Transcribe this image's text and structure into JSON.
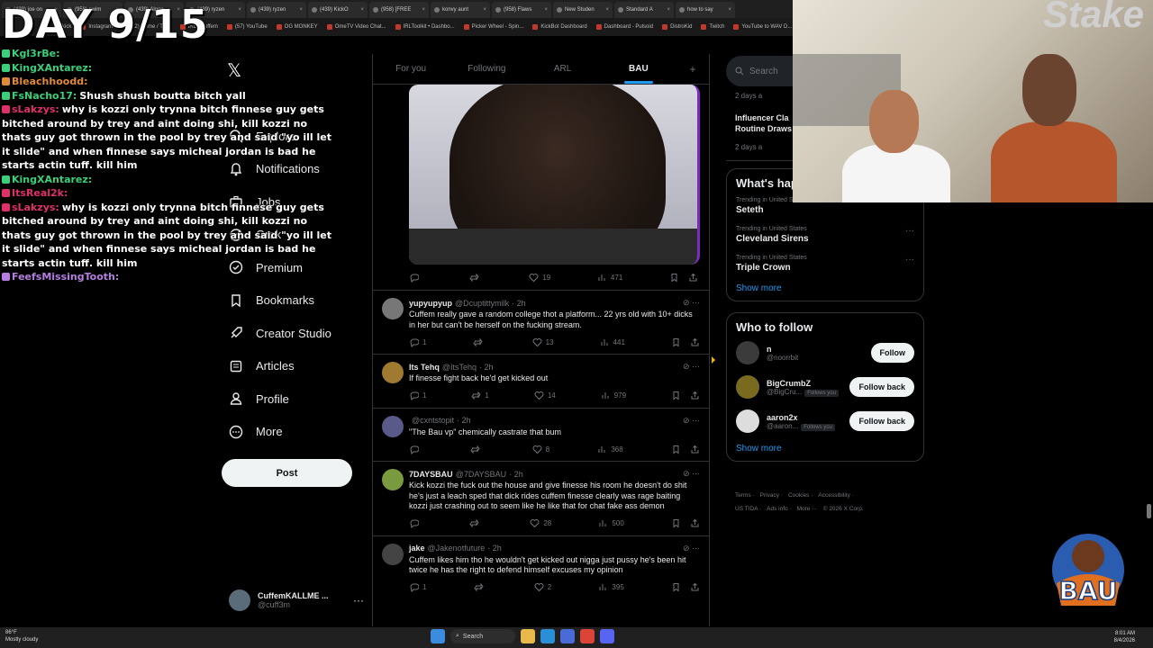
{
  "overlay": {
    "day": "DAY 9/15"
  },
  "browser": {
    "tabs": [
      "(439) joe on",
      "(958) swim",
      "(439) Algon",
      "(439) ryzen",
      "(439) ryzen",
      "(439) KickO",
      "(958) [FREE",
      "konvy aunt",
      "(958) Flaws",
      "New Studen",
      "Standard A",
      "how to say"
    ],
    "bookmarks": [
      "kick",
      "Instagram",
      "(12) Home / Twitt",
      "IRL | Cuffem",
      "(57) YouTube",
      "OG MONKEY",
      "OmeTV Video Chat...",
      "IRLToolkit • Dashbo...",
      "Picker Wheel - Spin...",
      "KickBot Dashboard",
      "Dashboard - Pulsoid",
      "DistroKid",
      "Twitch",
      "YouTube to WAV D..."
    ]
  },
  "chat": [
    {
      "user": "Kgl3rBe:",
      "text": "",
      "color": "#3ad07a"
    },
    {
      "user": "KingXAntarez:",
      "text": "",
      "color": "#3ad07a"
    },
    {
      "user": "Bleachhoodd:",
      "text": "",
      "color": "#e08a3c"
    },
    {
      "user": "FsNacho17:",
      "text": "Shush shush boutta bitch yall",
      "color": "#3ad07a"
    },
    {
      "user": "sLakzys:",
      "text": "why is kozzi only trynna bitch finnese guy gets bitched around by trey and aint doing shi, kill kozzi no thats guy got thrown in the pool by trey and said \"yo ill let it slide\" and when finnese says micheal jordan is bad he starts actin tuff. kill him",
      "color": "#e0306a"
    },
    {
      "user": "KingXAntarez:",
      "text": "",
      "color": "#3ad07a"
    },
    {
      "user": "ItsReal2k:",
      "text": "",
      "color": "#e0306a"
    },
    {
      "user": "sLakzys:",
      "text": "why is kozzi only trynna bitch finnese guy gets bitched around by trey and aint doing shi, kill kozzi no thats guy got thrown in the pool by trey and said \"yo ill let it slide\" and when finnese says micheal jordan is bad he starts actin tuff. kill him",
      "color": "#e0306a"
    },
    {
      "user": "FeefsMissingTooth:",
      "text": "",
      "color": "#b57ee0"
    }
  ],
  "nav": {
    "items": [
      {
        "label": "Explore",
        "icon": "search-icon"
      },
      {
        "label": "Notifications",
        "icon": "bell-icon"
      },
      {
        "label": "Jobs",
        "icon": "briefcase-icon"
      },
      {
        "label": "Grok",
        "icon": "grok-icon"
      },
      {
        "label": "Premium",
        "icon": "premium-icon"
      },
      {
        "label": "Bookmarks",
        "icon": "bookmark-icon"
      },
      {
        "label": "Creator Studio",
        "icon": "rocket-icon"
      },
      {
        "label": "Articles",
        "icon": "articles-icon"
      },
      {
        "label": "Profile",
        "icon": "profile-icon"
      },
      {
        "label": "More",
        "icon": "more-icon"
      }
    ],
    "post": "Post",
    "account": {
      "name": "CuffemKALLME ...",
      "handle": "@cuff3m"
    }
  },
  "timeline": {
    "tabs": [
      "For you",
      "Following",
      "ARL",
      "BAU"
    ],
    "active_tab": "BAU",
    "top_tweet_actions": {
      "replies": "",
      "reposts": "",
      "likes": "19",
      "views": "471"
    },
    "tweets": [
      {
        "name": "yupyupyup",
        "handle": "@Dcuptittymilk",
        "time": "· 2h",
        "text": "Cuffem really gave a random college thot a platform... 22 yrs old with 10+ dicks in her but can't be herself on the fucking stream.",
        "replies": "1",
        "reposts": "",
        "likes": "13",
        "views": "441",
        "avatar": "#777"
      },
      {
        "name": "Its Tehq",
        "handle": "@ItsTehq",
        "time": "· 2h",
        "text": "If finesse fight back he'd get kicked out",
        "replies": "1",
        "reposts": "1",
        "likes": "14",
        "views": "979",
        "avatar": "#a07a30"
      },
      {
        "name": "",
        "handle": "@cxntstopit",
        "time": "· 2h",
        "text": "\"The Bau vp\" chemically castrate that bum",
        "replies": "",
        "reposts": "",
        "likes": "8",
        "views": "368",
        "avatar": "#5a5a8a"
      },
      {
        "name": "7DAYSBAU",
        "handle": "@7DAYSBAU",
        "time": "· 2h",
        "text": "Kick kozzi the fuck out the house and give finesse his room he doesn't do shit he's just a leach sped that dick rides cuffem finesse clearly was rage baiting kozzi just crashing out to seem like he like that for chat fake ass demon",
        "replies": "",
        "reposts": "",
        "likes": "28",
        "views": "500",
        "avatar": "#7a9a40"
      },
      {
        "name": "jake",
        "handle": "@Jakenotfuture",
        "time": "· 2h",
        "text": "Cuffem likes him tho he wouldn't get kicked out nigga just pussy he's been hit twice he has the right to defend himself excuses my opinion",
        "replies": "1",
        "reposts": "",
        "likes": "2",
        "views": "395",
        "avatar": "#444"
      }
    ]
  },
  "right": {
    "search_placeholder": "Search",
    "top_items": [
      {
        "meta": "2 days a",
        "title": ""
      },
      {
        "meta": "",
        "title": "Influencer Cla Routine Draws"
      },
      {
        "meta": "2 days a",
        "title": ""
      }
    ],
    "happening_title": "What's hap",
    "trends": [
      {
        "context": "Trending in United States",
        "title": "Seteth"
      },
      {
        "context": "Trending in United States",
        "title": "Cleveland Sirens"
      },
      {
        "context": "Trending in United States",
        "title": "Triple Crown"
      }
    ],
    "show_more": "Show more",
    "who_to_follow_title": "Who to follow",
    "follows": [
      {
        "name": "n",
        "handle": "@noorrbit",
        "follows_you": "",
        "button": "Follow",
        "avatar": "#3b3b3b"
      },
      {
        "name": "BigCrumbZ",
        "handle": "@BigCru...",
        "follows_you": "Follows you",
        "button": "Follow back",
        "avatar": "#7a6a20"
      },
      {
        "name": "aaron2x",
        "handle": "@aaron...",
        "follows_you": "Follows you",
        "button": "Follow back",
        "avatar": "#dddddd"
      }
    ],
    "footer": [
      "Terms ·",
      "Privacy ·",
      "Cookies ·",
      "Accessibility ·",
      "US TIDA ·",
      "Ads info ·",
      "More ···",
      "© 2026 X Corp."
    ]
  },
  "cam": {
    "brand": "Stake"
  },
  "logo": {
    "text": "BAU"
  },
  "taskbar": {
    "weather_temp": "86°F",
    "weather_text": "Mostly cloudy",
    "search": "Search",
    "time": "8:01 AM",
    "date": "8/4/2026"
  },
  "colors": {
    "accent": "#1d9bf0",
    "bg": "#000000",
    "border": "#2f3336",
    "muted": "#71767b"
  }
}
